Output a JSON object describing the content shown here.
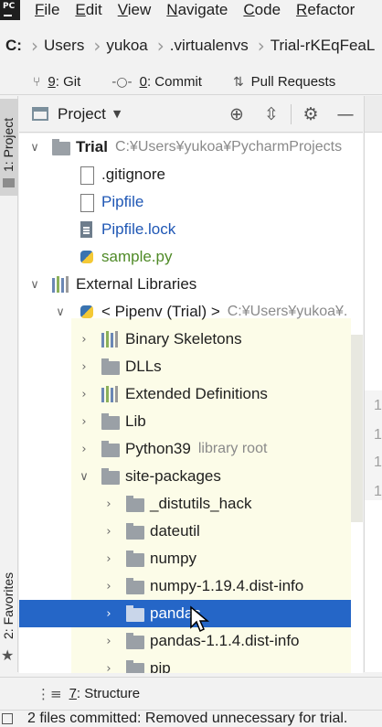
{
  "menubar": {
    "logo_text": "PC",
    "items": [
      {
        "key": "F",
        "rest": "ile"
      },
      {
        "key": "E",
        "rest": "dit"
      },
      {
        "key": "V",
        "rest": "iew"
      },
      {
        "key": "N",
        "rest": "avigate"
      },
      {
        "key": "C",
        "rest": "ode"
      },
      {
        "key": "R",
        "rest": "efactor"
      }
    ]
  },
  "breadcrumb": {
    "drive": "C:",
    "items": [
      "Users",
      "yukoa",
      ".virtualenvs",
      "Trial-rKEqFeaL"
    ]
  },
  "vcs": {
    "git": {
      "key": "9",
      "label": ": Git"
    },
    "commit": {
      "key": "0",
      "label": ": Commit"
    },
    "pull": {
      "label": "Pull Requests"
    }
  },
  "left_strip": {
    "project_tab": "1: Project",
    "favorites_tab": "2: Favorites"
  },
  "panel": {
    "title": "Project"
  },
  "tree": {
    "rows": [
      {
        "label": "Trial",
        "hint": "C:¥Users¥yukoa¥PycharmProjects"
      },
      {
        "label": ".gitignore"
      },
      {
        "label": "Pipfile"
      },
      {
        "label": "Pipfile.lock"
      },
      {
        "label": "sample.py"
      },
      {
        "label": "External Libraries"
      },
      {
        "label": "< Pipenv (Trial) >",
        "hint": "C:¥Users¥yukoa¥."
      },
      {
        "label": "Binary Skeletons"
      },
      {
        "label": "DLLs"
      },
      {
        "label": "Extended Definitions"
      },
      {
        "label": "Lib"
      },
      {
        "label": "Python39",
        "hint": "library root"
      },
      {
        "label": "site-packages"
      },
      {
        "label": "_distutils_hack"
      },
      {
        "label": "dateutil"
      },
      {
        "label": "numpy"
      },
      {
        "label": "numpy-1.19.4.dist-info"
      },
      {
        "label": "pandas"
      },
      {
        "label": "pandas-1.1.4.dist-info"
      },
      {
        "label": "pip"
      }
    ]
  },
  "editor": {
    "gutter": [
      "1",
      "1",
      "1",
      "1"
    ]
  },
  "structure": {
    "key": "7",
    "label": ": Structure"
  },
  "status": {
    "text": "2 files committed: Removed unnecessary for trial."
  }
}
